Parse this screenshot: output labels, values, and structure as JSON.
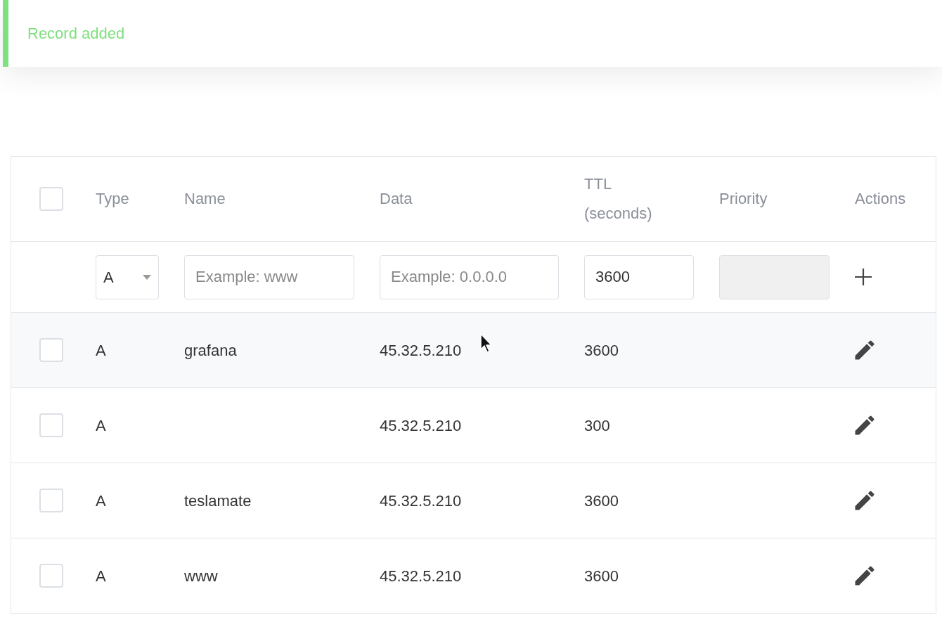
{
  "toast": {
    "message": "Record added"
  },
  "table": {
    "header_checkbox": {
      "checked": false
    },
    "columns": [
      "Type",
      "Name",
      "Data",
      "TTL (seconds)",
      "Priority",
      "Actions"
    ],
    "new_record": {
      "type": "A",
      "name_placeholder": "Example: www",
      "data_placeholder": "Example: 0.0.0.0",
      "ttl": "3600",
      "priority_disabled": true
    },
    "rows": [
      {
        "type": "A",
        "name": "grafana",
        "data": "45.32.5.210",
        "ttl": "3600",
        "checked": false,
        "hovered": true
      },
      {
        "type": "A",
        "name": "",
        "data": "45.32.5.210",
        "ttl": "300",
        "checked": false,
        "hovered": false
      },
      {
        "type": "A",
        "name": "teslamate",
        "data": "45.32.5.210",
        "ttl": "3600",
        "checked": false,
        "hovered": false
      },
      {
        "type": "A",
        "name": "www",
        "data": "45.32.5.210",
        "ttl": "3600",
        "checked": false,
        "hovered": false
      }
    ]
  }
}
